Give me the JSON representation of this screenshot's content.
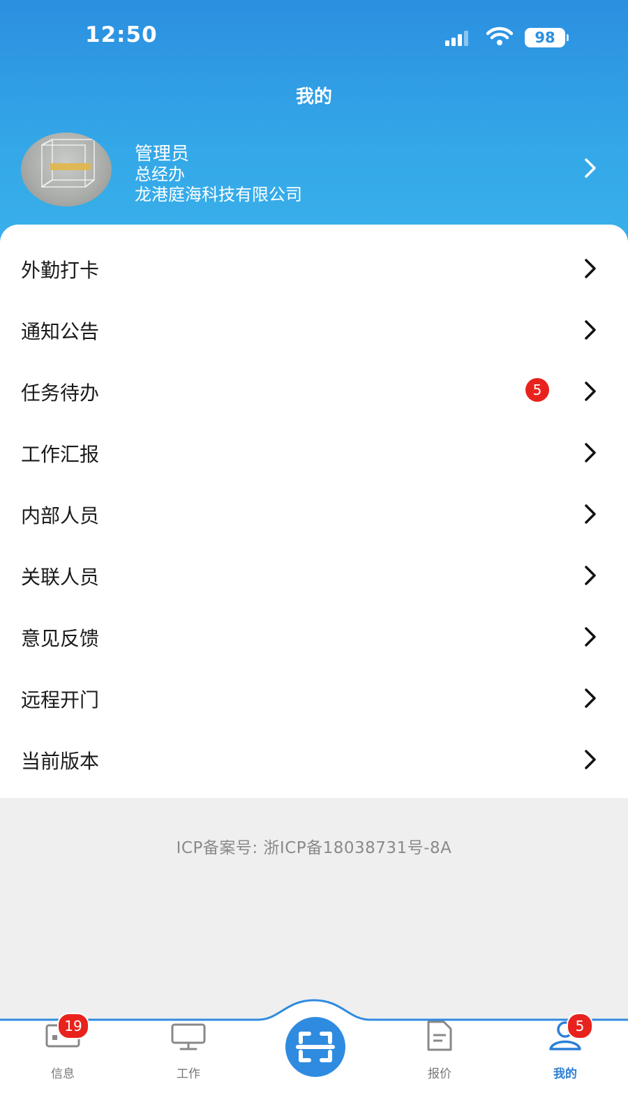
{
  "status_bar": {
    "time": "12:50",
    "battery": "98"
  },
  "header": {
    "title": "我的"
  },
  "profile": {
    "name": "管理员",
    "department": "总经办",
    "company": "龙港庭海科技有限公司"
  },
  "menu": [
    {
      "label": "外勤打卡"
    },
    {
      "label": "通知公告"
    },
    {
      "label": "任务待办",
      "badge": "5"
    },
    {
      "label": "工作汇报"
    },
    {
      "label": "内部人员"
    },
    {
      "label": "关联人员"
    },
    {
      "label": "意见反馈"
    },
    {
      "label": "远程开门"
    },
    {
      "label": "当前版本"
    }
  ],
  "footer": {
    "icp": "ICP备案号: 浙ICP备18038731号-8A"
  },
  "tabbar": {
    "items": [
      {
        "label": "信息",
        "badge": "19",
        "icon": "message-icon"
      },
      {
        "label": "工作",
        "icon": "monitor-icon"
      },
      {
        "label": "",
        "icon": "scan-icon"
      },
      {
        "label": "报价",
        "icon": "document-icon"
      },
      {
        "label": "我的",
        "badge": "5",
        "icon": "user-icon",
        "active": true
      }
    ]
  },
  "colors": {
    "primary": "#2b8fe0",
    "badge": "#e8231e",
    "active_tab": "#2b7fd6",
    "background": "#efeff0"
  }
}
